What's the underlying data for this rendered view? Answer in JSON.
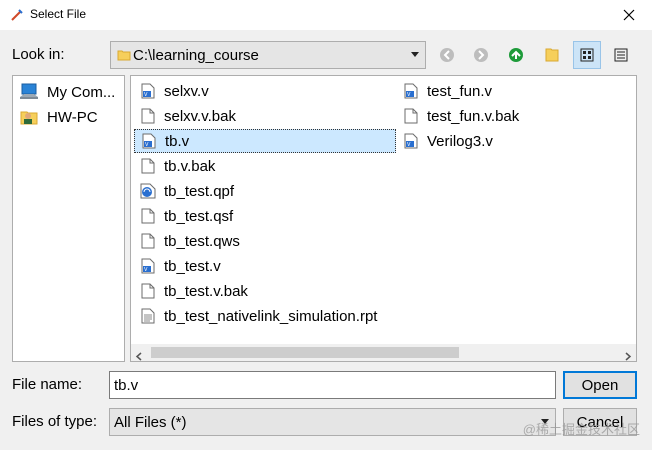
{
  "window": {
    "title": "Select File"
  },
  "look_in": {
    "label": "Look in:",
    "path": "C:\\learning_course"
  },
  "toolbar": {
    "back_icon": "back-arrow-icon",
    "forward_icon": "forward-arrow-icon",
    "up_icon": "parent-folder-up-icon",
    "new_folder_icon": "new-folder-icon",
    "list_view_icon": "list-view-icon",
    "detail_view_icon": "detail-view-icon"
  },
  "sidebar": {
    "items": [
      {
        "label": "My Com...",
        "icon": "computer-icon"
      },
      {
        "label": "HW-PC",
        "icon": "user-folder-icon"
      }
    ]
  },
  "files": {
    "items": [
      {
        "name": "selxv.v",
        "icon": "verilog-file-icon"
      },
      {
        "name": "selxv.v.bak",
        "icon": "blank-file-icon"
      },
      {
        "name": "tb.v",
        "icon": "verilog-file-icon"
      },
      {
        "name": "tb.v.bak",
        "icon": "blank-file-icon"
      },
      {
        "name": "tb_test.qpf",
        "icon": "quartus-project-icon"
      },
      {
        "name": "tb_test.qsf",
        "icon": "blank-file-icon"
      },
      {
        "name": "tb_test.qws",
        "icon": "blank-file-icon"
      },
      {
        "name": "tb_test.v",
        "icon": "verilog-file-icon"
      },
      {
        "name": "tb_test.v.bak",
        "icon": "blank-file-icon"
      },
      {
        "name": "tb_test_nativelink_simulation.rpt",
        "icon": "text-file-icon"
      },
      {
        "name": "test_fun.v",
        "icon": "verilog-file-icon"
      },
      {
        "name": "test_fun.v.bak",
        "icon": "blank-file-icon"
      },
      {
        "name": "Verilog3.v",
        "icon": "verilog-file-icon"
      }
    ],
    "selected": "tb.v"
  },
  "file_name": {
    "label": "File name:",
    "value": "tb.v"
  },
  "file_type": {
    "label": "Files of type:",
    "value": "All Files (*)"
  },
  "buttons": {
    "open": "Open",
    "cancel": "Cancel"
  },
  "watermark": "@稀土掘金技术社区",
  "colors": {
    "accent": "#0078d7",
    "selection": "#cce8ff",
    "up_arrow": "#1e9b3a",
    "folder": "#f6cf5b"
  }
}
